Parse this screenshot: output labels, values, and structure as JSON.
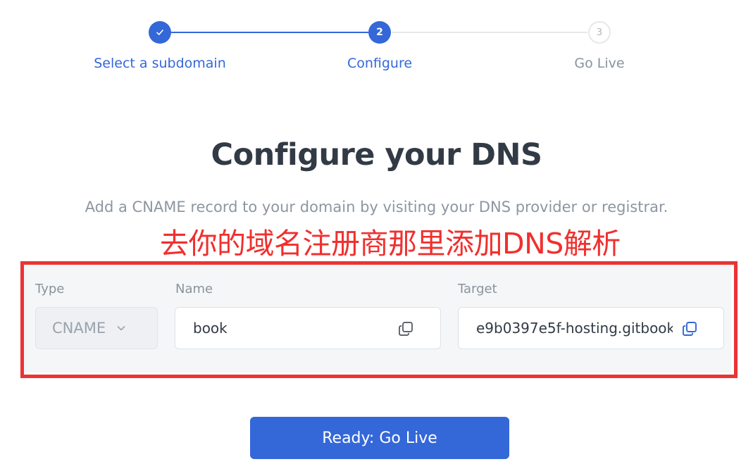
{
  "stepper": {
    "steps": [
      {
        "number": "",
        "label": "Select a subdomain",
        "state": "completed"
      },
      {
        "number": "2",
        "label": "Configure",
        "state": "active"
      },
      {
        "number": "3",
        "label": "Go Live",
        "state": "pending"
      }
    ]
  },
  "main": {
    "title": "Configure your DNS",
    "subtitle": "Add a CNAME record to your domain by visiting your DNS provider or registrar.",
    "annotation": "去你的域名注册商那里添加DNS解析"
  },
  "dns_record": {
    "type_label": "Type",
    "type_value": "CNAME",
    "name_label": "Name",
    "name_value": "book",
    "target_label": "Target",
    "target_value": "e9b0397e5f-hosting.gitbook"
  },
  "actions": {
    "go_live_label": "Ready: Go Live"
  },
  "icons": {
    "step1": "check-icon",
    "type_select": "chevron-down-icon",
    "copy": "copy-icon"
  },
  "colors": {
    "accent": "#3468d8",
    "annotation": "#f0302e",
    "highlight_border": "#ea3434"
  }
}
